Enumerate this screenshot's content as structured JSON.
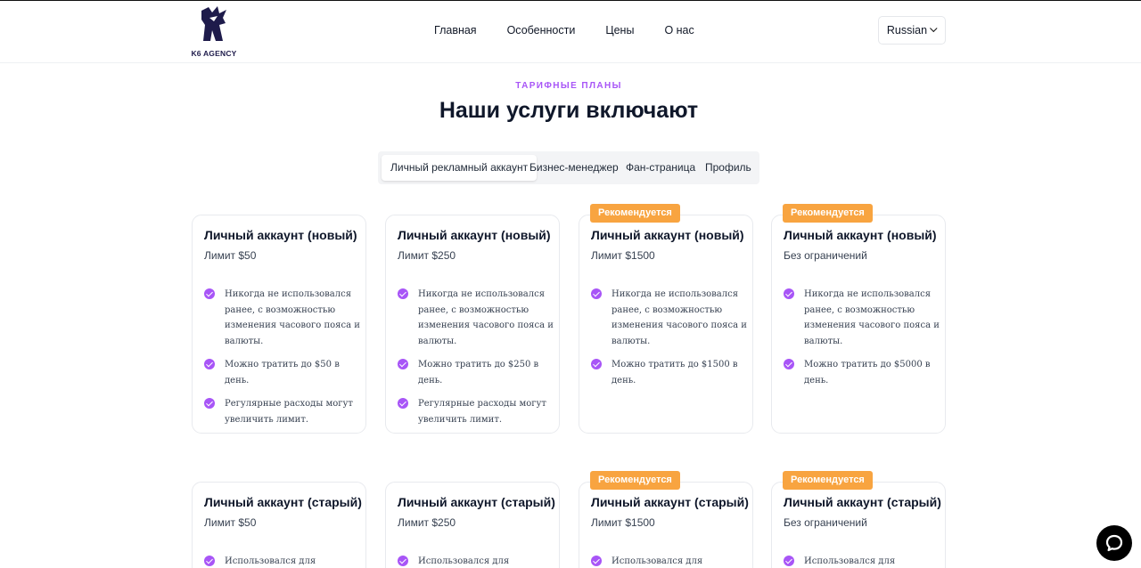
{
  "brand": {
    "logo_text": "K6 AGENCY"
  },
  "nav": {
    "items": [
      {
        "label": "Главная"
      },
      {
        "label": "Особенности"
      },
      {
        "label": "Цены"
      },
      {
        "label": "О нас"
      }
    ],
    "language": "Russian"
  },
  "section": {
    "eyebrow": "ТАРИФНЫЕ ПЛАНЫ",
    "title": "Наши услуги включают"
  },
  "tabs": [
    {
      "label": "Личный рекламный аккаунт",
      "active": true
    },
    {
      "label": "Бизнес-менеджер",
      "active": false
    },
    {
      "label": "Фан-страница",
      "active": false
    },
    {
      "label": "Профиль",
      "active": false
    }
  ],
  "badge_label": "Рекомендуется",
  "cards_row1": [
    {
      "title": "Личный аккаунт (новый)",
      "subtitle": "Лимит $50",
      "recommended": false,
      "features": [
        "Никогда не использовался ранее, с возможностью изменения часового пояса и валюты.",
        "Можно тратить до $50 в день.",
        "Регулярные расходы могут увеличить лимит."
      ]
    },
    {
      "title": "Личный аккаунт (новый)",
      "subtitle": "Лимит $250",
      "recommended": false,
      "features": [
        "Никогда не использовался ранее, с возможностью изменения часового пояса и валюты.",
        "Можно тратить до $250 в день.",
        "Регулярные расходы могут увеличить лимит."
      ]
    },
    {
      "title": "Личный аккаунт (новый)",
      "subtitle": "Лимит $1500",
      "recommended": true,
      "features": [
        "Никогда не использовался ранее, с возможностью изменения часового пояса и валюты.",
        "Можно тратить до $1500 в день."
      ]
    },
    {
      "title": "Личный аккаунт (новый)",
      "subtitle": "Без ограничений",
      "recommended": true,
      "features": [
        "Никогда не использовался ранее, с возможностью изменения часового пояса и валюты.",
        "Можно тратить до $5000 в день."
      ]
    }
  ],
  "cards_row2": [
    {
      "title": "Личный аккаунт (старый)",
      "subtitle": "Лимит $50",
      "recommended": false,
      "features": [
        "Использовался для"
      ]
    },
    {
      "title": "Личный аккаунт (старый)",
      "subtitle": "Лимит $250",
      "recommended": false,
      "features": [
        "Использовался для"
      ]
    },
    {
      "title": "Личный аккаунт (старый)",
      "subtitle": "Лимит $1500",
      "recommended": true,
      "features": [
        "Использовался для"
      ]
    },
    {
      "title": "Личный аккаунт (старый)",
      "subtitle": "Без ограничений",
      "recommended": true,
      "features": [
        "Использовался для"
      ]
    }
  ],
  "colors": {
    "accent": "#a855f7",
    "badge": "#f8a440",
    "text": "#0f172a"
  },
  "icons": {
    "logo": "lion-logo-icon",
    "check": "check-circle-icon",
    "chat": "chat-bubble-icon",
    "chevron": "chevron-down-icon"
  }
}
